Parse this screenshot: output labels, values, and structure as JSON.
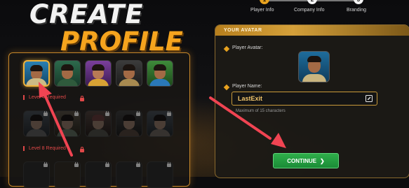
{
  "title": {
    "line1": "CREATE",
    "line2": "PROFILE"
  },
  "stepper": {
    "steps": [
      {
        "number": "1",
        "label": "Player Info",
        "active": true
      },
      {
        "number": "2",
        "label": "Company Info",
        "active": false
      },
      {
        "number": "3",
        "label": "Branding",
        "active": false
      }
    ]
  },
  "avatar_picker": {
    "level_labels": [
      "Level 4 Required",
      "Level 8 Required"
    ]
  },
  "avatar_panel": {
    "header": "YOUR AVATAR",
    "avatar_label": "Player Avatar:",
    "name_label": "Player Name:",
    "name_value": "LastExit",
    "name_hint": "Maximum of 15 characters",
    "continue_label": "CONTINUE"
  },
  "colors": {
    "accent": "#e8a21f",
    "continue": "#23a041",
    "locked_text": "#e04848",
    "annotation_arrow": "#f04452"
  }
}
